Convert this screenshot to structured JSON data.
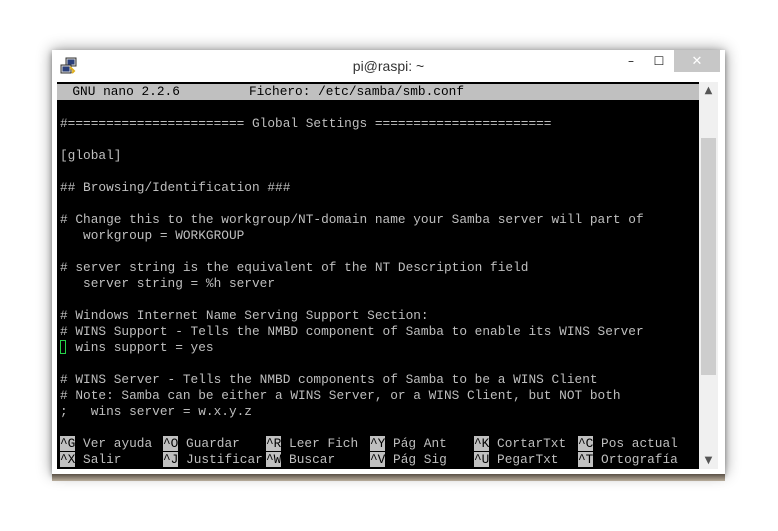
{
  "window": {
    "title": "pi@raspi: ~",
    "controls": {
      "minimize": "–",
      "maximize": "☐",
      "close": "✕"
    }
  },
  "nano": {
    "header": "  GNU nano 2.2.6         Fichero: /etc/samba/smb.conf",
    "lines": [
      "#======================= Global Settings =======================",
      "",
      "[global]",
      "",
      "## Browsing/Identification ###",
      "",
      "# Change this to the workgroup/NT-domain name your Samba server will part of",
      "   workgroup = WORKGROUP",
      "",
      "",
      "# server string is the equivalent of the NT Description field",
      "   server string = %h server",
      "",
      "# Windows Internet Name Serving Support Section:",
      "# WINS Support - Tells the NMBD component of Samba to enable its WINS Server",
      "  wins support = yes",
      "",
      "# WINS Server - Tells the NMBD components of Samba to be a WINS Client",
      "# Note: Samba can be either a WINS Server, or a WINS Client, but NOT both",
      ";   wins server = w.x.y.z"
    ],
    "shortcuts_row1": [
      {
        "key": "^G",
        "label": "Ver ayuda"
      },
      {
        "key": "^O",
        "label": "Guardar"
      },
      {
        "key": "^R",
        "label": "Leer Fich"
      },
      {
        "key": "^Y",
        "label": "Pág Ant"
      },
      {
        "key": "^K",
        "label": "CortarTxt"
      },
      {
        "key": "^C",
        "label": "Pos actual"
      }
    ],
    "shortcuts_row2": [
      {
        "key": "^X",
        "label": "Salir"
      },
      {
        "key": "^J",
        "label": "Justificar"
      },
      {
        "key": "^W",
        "label": "Buscar"
      },
      {
        "key": "^V",
        "label": "Pág Sig"
      },
      {
        "key": "^U",
        "label": "PegarTxt"
      },
      {
        "key": "^T",
        "label": "Ortografía"
      }
    ]
  },
  "scrollbar": {
    "up_arrow": "▲",
    "down_arrow": "▼",
    "position": 0.34,
    "visible_fraction": 0.67
  },
  "colors": {
    "terminal_bg": "#000000",
    "terminal_text": "#bfbfbf",
    "header_bar": "#c0c0c0",
    "cursor": "#27d24a"
  },
  "icons": {
    "app": "putty-icon"
  }
}
